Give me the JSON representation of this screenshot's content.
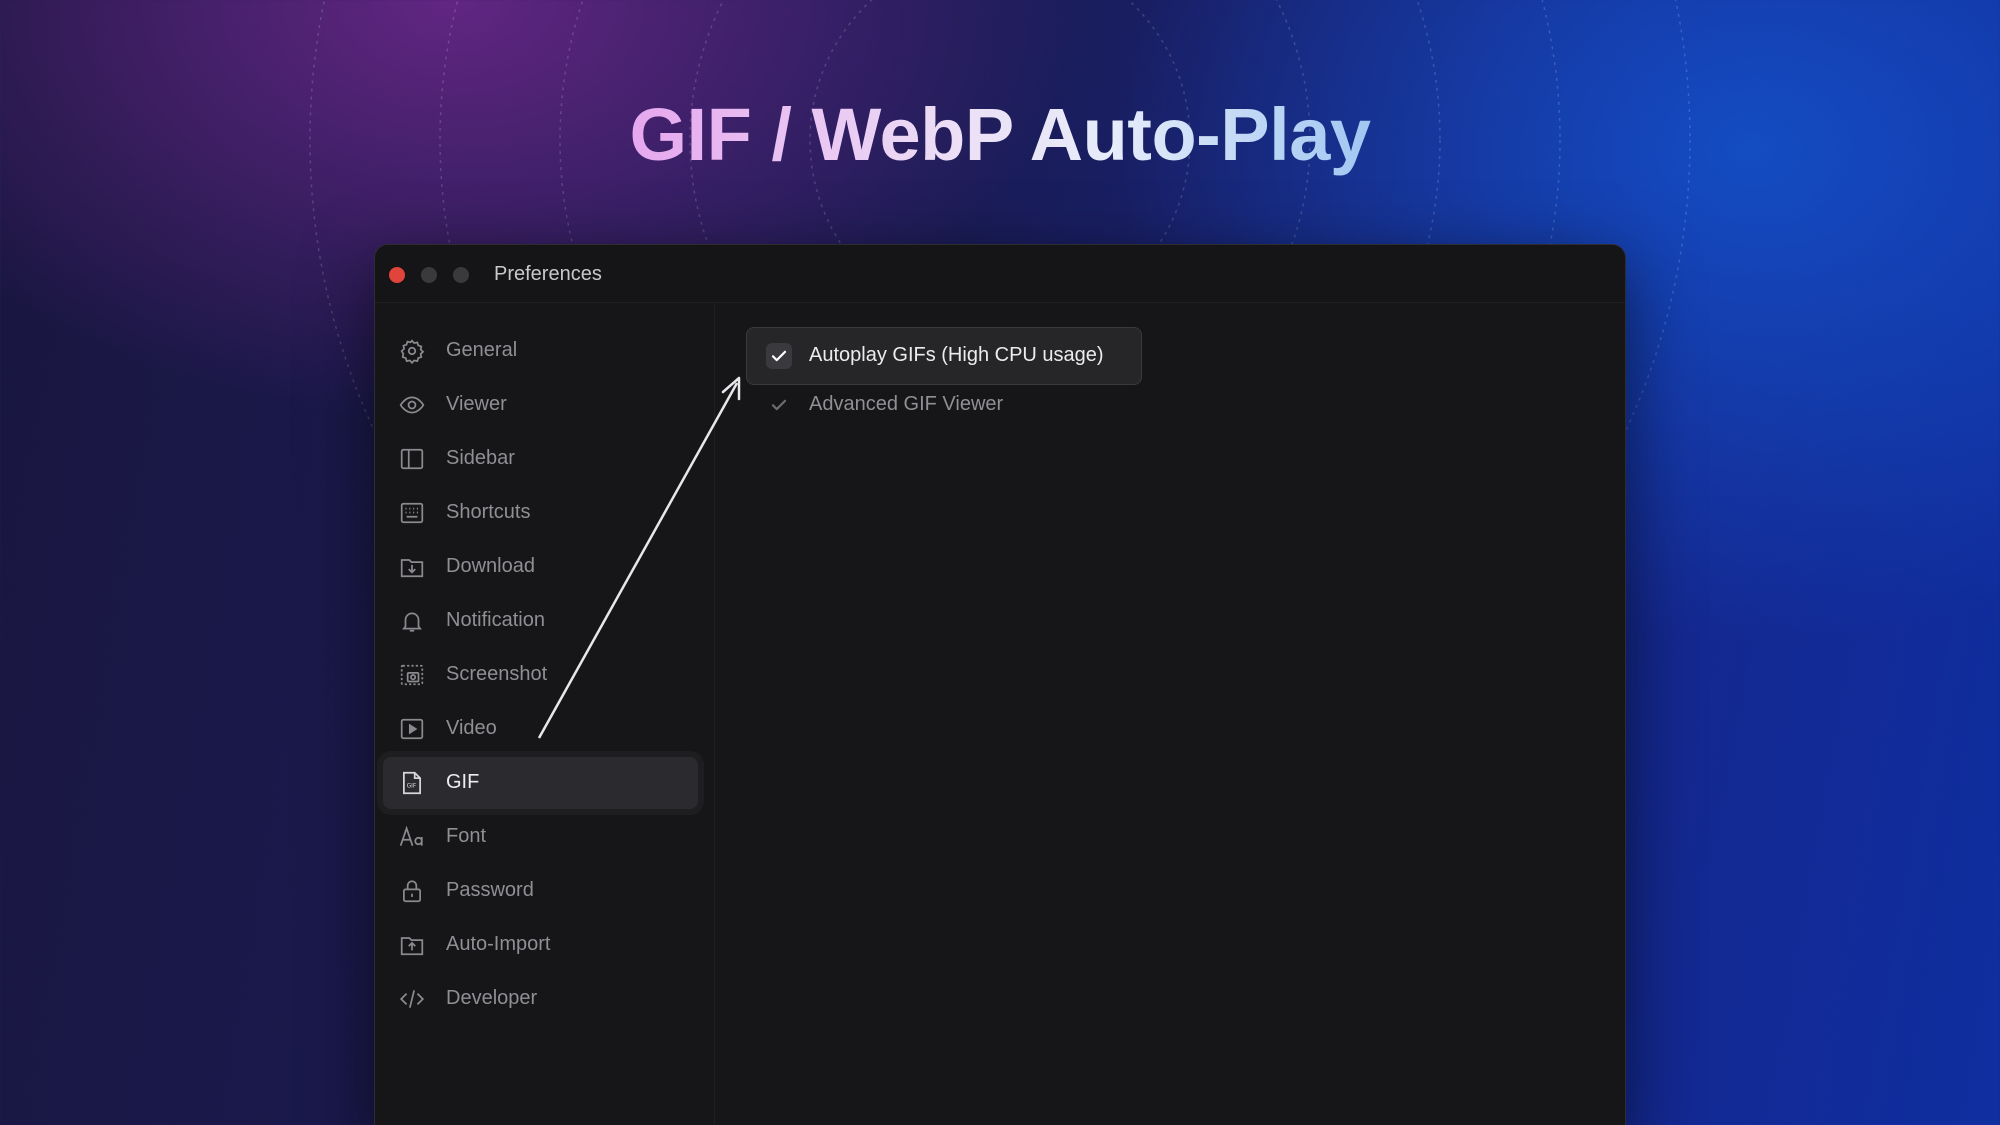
{
  "headline": "GIF / WebP Auto-Play",
  "window": {
    "title": "Preferences"
  },
  "sidebar": {
    "items": [
      {
        "label": "General",
        "icon": "gear-icon",
        "active": false
      },
      {
        "label": "Viewer",
        "icon": "eye-icon",
        "active": false
      },
      {
        "label": "Sidebar",
        "icon": "sidebar-icon",
        "active": false
      },
      {
        "label": "Shortcuts",
        "icon": "keyboard-icon",
        "active": false
      },
      {
        "label": "Download",
        "icon": "download-folder-icon",
        "active": false
      },
      {
        "label": "Notification",
        "icon": "bell-icon",
        "active": false
      },
      {
        "label": "Screenshot",
        "icon": "screenshot-icon",
        "active": false
      },
      {
        "label": "Video",
        "icon": "play-icon",
        "active": false
      },
      {
        "label": "GIF",
        "icon": "gif-file-icon",
        "active": true
      },
      {
        "label": "Font",
        "icon": "font-icon",
        "active": false
      },
      {
        "label": "Password",
        "icon": "lock-icon",
        "active": false
      },
      {
        "label": "Auto-Import",
        "icon": "upload-folder-icon",
        "active": false
      },
      {
        "label": "Developer",
        "icon": "code-icon",
        "active": false
      }
    ]
  },
  "gif_settings": {
    "autoplay": {
      "label": "Autoplay GIFs (High CPU usage)",
      "checked": true
    },
    "advanced_viewer": {
      "label": "Advanced GIF Viewer",
      "checked": true
    }
  },
  "colors": {
    "accent_red": "#e0443a",
    "window_bg": "#161618"
  }
}
